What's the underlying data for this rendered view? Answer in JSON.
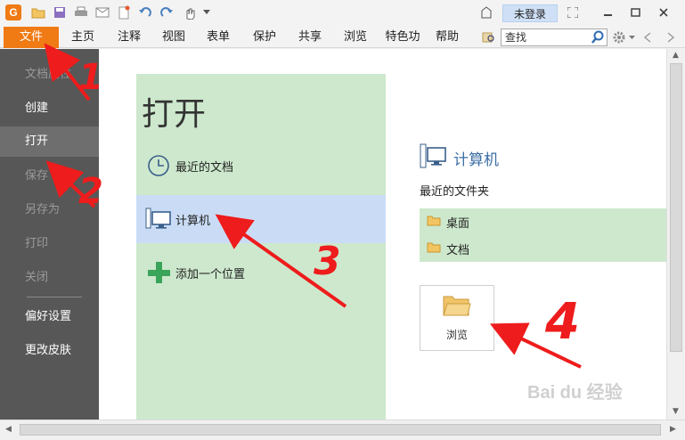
{
  "titlebar": {
    "login_label": "未登录"
  },
  "menubar": {
    "file": "文件",
    "items": [
      "主页",
      "注释",
      "视图",
      "表单",
      "保护",
      "共享",
      "浏览",
      "特色功",
      "帮助"
    ],
    "search_placeholder": "查找"
  },
  "sidebar": {
    "items": [
      {
        "label": "文档属性",
        "state": "disabled"
      },
      {
        "label": "创建",
        "state": "enabled"
      },
      {
        "label": "打开",
        "state": "active"
      },
      {
        "label": "保存",
        "state": "disabled"
      },
      {
        "label": "另存为",
        "state": "disabled"
      },
      {
        "label": "打印",
        "state": "disabled"
      },
      {
        "label": "关闭",
        "state": "disabled"
      },
      {
        "label": "偏好设置",
        "state": "enabled"
      },
      {
        "label": "更改皮肤",
        "state": "enabled"
      }
    ]
  },
  "open_panel": {
    "title": "打开",
    "options": [
      "最近的文档",
      "计算机",
      "添加一个位置"
    ]
  },
  "right_pane": {
    "heading": "计算机",
    "recent_label": "最近的文件夹",
    "folders": [
      "桌面",
      "文档"
    ],
    "browse_label": "浏览"
  },
  "annotations": {
    "numbers": [
      "1",
      "2",
      "3",
      "4"
    ],
    "watermark": "Bai du 经验"
  },
  "colors": {
    "accent": "#f07a14",
    "sidebar": "#575757",
    "panel_green": "#cde8cd",
    "selected_blue": "#cadcf5",
    "arrow_red": "#ee1c1c"
  }
}
